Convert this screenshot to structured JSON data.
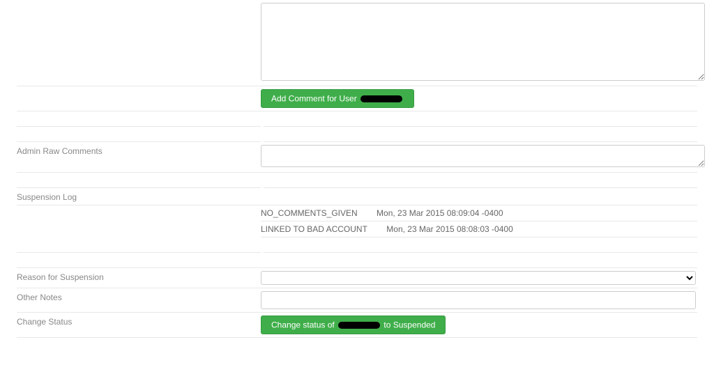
{
  "comment_section": {
    "add_button_prefix": "Add Comment for User "
  },
  "admin_raw_comments": {
    "label": "Admin Raw Comments",
    "value": ""
  },
  "suspension_log": {
    "label": "Suspension Log",
    "entries": [
      {
        "reason": "NO_COMMENTS_GIVEN",
        "time": "Mon, 23 Mar 2015 08:09:04 -0400"
      },
      {
        "reason": "LINKED TO BAD ACCOUNT",
        "time": "Mon, 23 Mar 2015 08:08:03 -0400"
      }
    ]
  },
  "reason_for_suspension": {
    "label": "Reason for Suspension",
    "selected": ""
  },
  "other_notes": {
    "label": "Other Notes",
    "value": ""
  },
  "change_status": {
    "label": "Change Status",
    "button_prefix": "Change status of ",
    "button_suffix": " to Suspended"
  }
}
